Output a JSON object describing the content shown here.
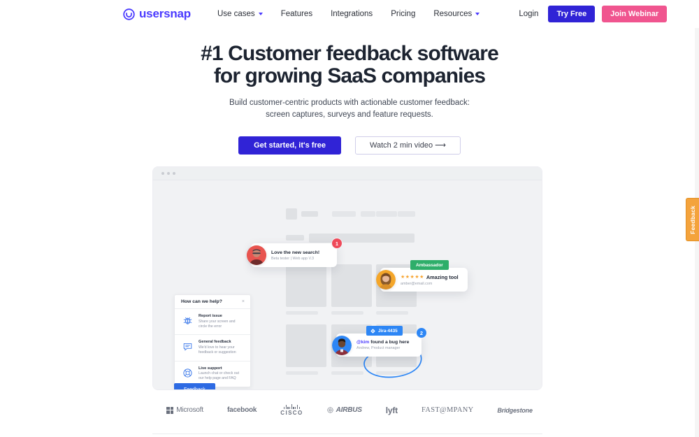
{
  "brand": {
    "name": "usersnap",
    "logo_icon": "smile-circle-icon",
    "accent": "#4a3aff",
    "cta_blue": "#3023d6",
    "pink": "#f0558f"
  },
  "nav": {
    "links": [
      {
        "label": "Use cases",
        "has_dropdown": true
      },
      {
        "label": "Features",
        "has_dropdown": false
      },
      {
        "label": "Integrations",
        "has_dropdown": false
      },
      {
        "label": "Pricing",
        "has_dropdown": false
      },
      {
        "label": "Resources",
        "has_dropdown": true
      }
    ],
    "login": "Login",
    "try_free": "Try Free",
    "join_webinar": "Join Webinar"
  },
  "hero": {
    "headline": "#1 Customer feedback software for growing SaaS companies",
    "sub_line1": "Build customer-centric products with actionable customer feedback:",
    "sub_line2": "screen captures, surveys and feature requests.",
    "cta_primary": "Get started, it's free",
    "cta_secondary": "Watch 2 min video ⟶"
  },
  "mockup": {
    "window_dots": 3,
    "help_widget": {
      "title": "How can we help?",
      "close_icon": "close-icon",
      "rows": [
        {
          "icon": "bug-icon",
          "title": "Report issue",
          "desc_line1": "Share your screen and",
          "desc_line2": "circle the error"
        },
        {
          "icon": "chat-bubble-icon",
          "title": "General feedback",
          "desc_line1": "We'd love to hear your",
          "desc_line2": "feedback or suggestion"
        },
        {
          "icon": "lifebuoy-icon",
          "title": "Live support",
          "desc_line1": "Launch chat or check out",
          "desc_line2": "our help page and FAQ"
        }
      ]
    },
    "feedback_button": "Feedback",
    "annotations": [
      {
        "id": "love-the-new-search",
        "badge": "1",
        "badge_color": "#ef4a5a",
        "avatar": "avatar-beta-tester",
        "title": "Love the new search!",
        "subtitle": "Beta tester | Web app V.3"
      },
      {
        "id": "ambassador-review",
        "tag": "Ambassador",
        "tag_color": "#2eae6a",
        "avatar": "avatar-amber",
        "stars": 5,
        "title": "Amazing tool",
        "subtitle": "amber@email.com"
      },
      {
        "id": "jira-bug-report",
        "badge": "2",
        "badge_color": "#2d86f5",
        "tag": "Jira-4435",
        "tag_icon": "jira-icon",
        "tag_color2": "#2d86f5",
        "avatar": "avatar-andrew",
        "mention": "@kim",
        "title_rest": " found a bug here",
        "subtitle": "Andrew, Product manager"
      }
    ]
  },
  "logos": [
    {
      "name": "Microsoft",
      "style": "grid-mark"
    },
    {
      "name": "facebook",
      "style": "bold"
    },
    {
      "name": "CISCO",
      "style": "cisco"
    },
    {
      "name": "AIRBUS",
      "style": "airbus"
    },
    {
      "name": "lyft",
      "style": "bold"
    },
    {
      "name": "FAST@MPANY",
      "style": "serif"
    },
    {
      "name": "Bridgestone",
      "style": "italic"
    }
  ],
  "side_tab": {
    "label": "Feedback",
    "color": "#f4a33c"
  }
}
